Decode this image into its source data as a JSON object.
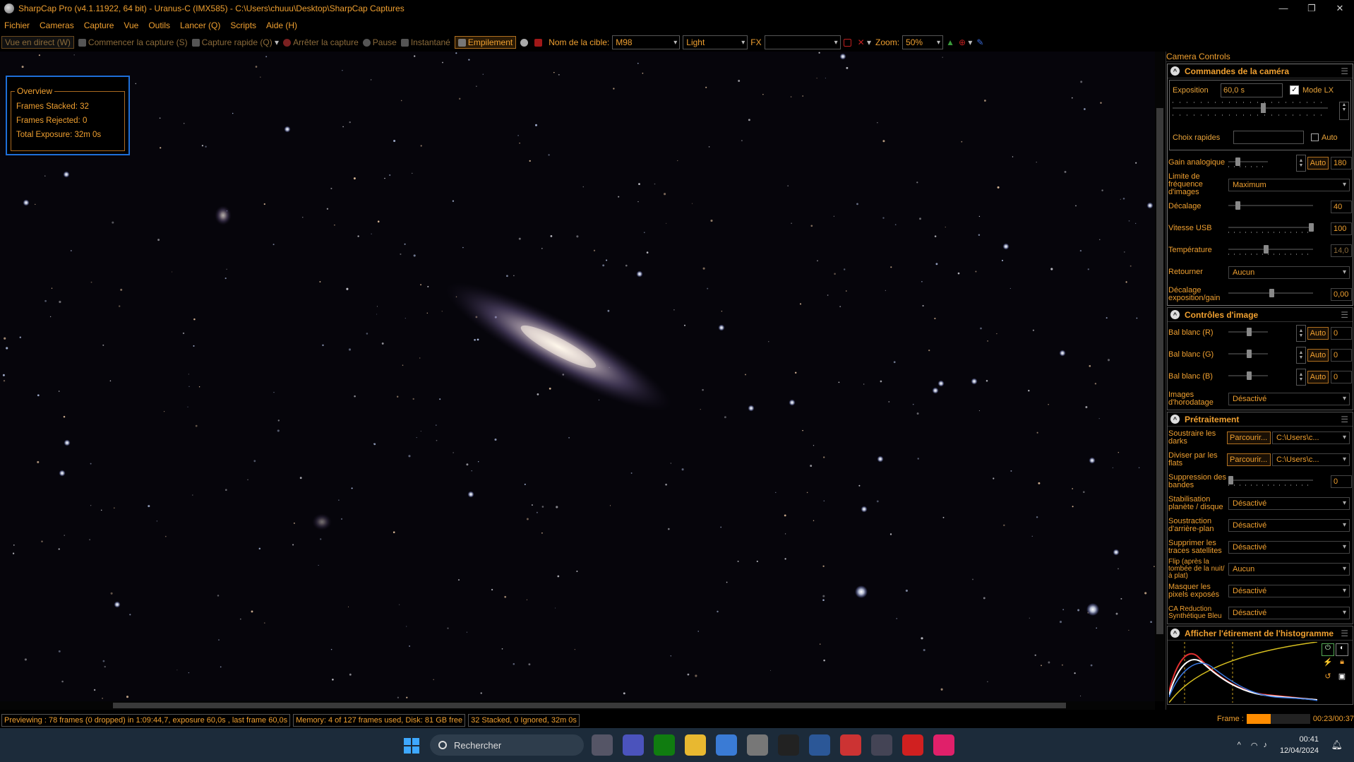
{
  "window": {
    "title": "SharpCap Pro (v4.1.11922, 64 bit) - Uranus-C (IMX585) - C:\\Users\\chuuu\\Desktop\\SharpCap Captures",
    "controls": [
      "—",
      "❐",
      "✕"
    ]
  },
  "menu": [
    "Fichier",
    "Cameras",
    "Capture",
    "Vue",
    "Outils",
    "Lancer (Q)",
    "Scripts",
    "Aide (H)"
  ],
  "toolbar": {
    "live_view": "Vue en direct (W)",
    "start_capture": "Commencer la capture (S)",
    "quick_capture": "Capture rapide (Q)",
    "stop_capture": "Arrêter la capture",
    "pause": "Pause",
    "snapshot": "Instantané",
    "stacking": "Empilement",
    "target_label": "Nom de la cible:",
    "target_value": "M98",
    "frame_type": "Light",
    "fx_label": "FX",
    "fx_value": "",
    "zoom_label": "Zoom:",
    "zoom_value": "50%"
  },
  "overview": {
    "title": "Overview",
    "frames_stacked": "Frames Stacked:   32",
    "frames_rejected": "Frames Rejected: 0",
    "total_exposure": "Total Exposure:    32m 0s"
  },
  "panel": {
    "title": "Camera Controls",
    "camera": {
      "header": "Commandes de la caméra",
      "exposure_label": "Exposition",
      "exposure_value": "60,0 s",
      "lx_mode": "Mode LX",
      "quick_choice": "Choix rapides",
      "auto": "Auto",
      "gain_label": "Gain analogique",
      "gain_value": "180",
      "framerate_label": "Limite de fréquence d'images",
      "framerate_value": "Maximum",
      "offset_label": "Décalage",
      "offset_value": "40",
      "usb_label": "Vitesse USB",
      "usb_value": "100",
      "temp_label": "Température",
      "temp_value": "14,0",
      "flip_label": "Retourner",
      "flip_value": "Aucun",
      "expgain_label": "Décalage exposition/gain",
      "expgain_value": "0,00"
    },
    "image": {
      "header": "Contrôles d'image",
      "wb_r_label": "Bal blanc (R)",
      "wb_r_value": "0",
      "wb_g_label": "Bal blanc (G)",
      "wb_g_value": "0",
      "wb_b_label": "Bal blanc (B)",
      "wb_b_value": "0",
      "timestamp_label": "Images d'horodatage",
      "timestamp_value": "Désactivé",
      "auto": "Auto"
    },
    "preproc": {
      "header": "Prétraitement",
      "darks_label": "Soustraire les darks",
      "flats_label": "Diviser par les flats",
      "browse": "Parcourir...",
      "path": "C:\\Users\\c...",
      "banding_label": "Suppression des bandes",
      "banding_value": "0",
      "stabilize_label": "Stabilisation planète / disque",
      "stabilize_value": "Désactivé",
      "bgsub_label": "Soustraction d'arrière-plan",
      "bgsub_value": "Désactivé",
      "sat_label": "Supprimer les traces satellites",
      "sat_value": "Désactivé",
      "flip_label": "Flip (après la tombée de la nuit/à plat)",
      "flip_value": "Aucun",
      "hotpix_label": "Masquer les pixels exposés",
      "hotpix_value": "Désactivé",
      "ca_label": "CA Reduction Synthétique Bleu",
      "ca_value": "Désactivé"
    },
    "histogram": {
      "header": "Afficher l'étirement de l'histogramme"
    }
  },
  "status": {
    "preview": "Previewing : 78 frames (0 dropped) in 1:09:44,7, exposure 60,0s , last frame 60,0s",
    "memory": "Memory: 4 of 127 frames used, Disk: 81 GB free",
    "stack": "32 Stacked, 0 Ignored, 32m 0s",
    "frame_label": "Frame :",
    "frame_time": "00:23/00:37",
    "frame_progress": 0.38
  },
  "taskbar": {
    "search": "Rechercher",
    "time": "00:41",
    "date": "12/04/2024",
    "app_icons": [
      "task-view-icon",
      "teams-icon",
      "xbox-icon",
      "file-explorer-icon",
      "store-icon",
      "pen-icon",
      "moon-icon",
      "stellarium-icon",
      "multi-icon",
      "sharpcap-icon",
      "asi-icon",
      "other-app-icon"
    ]
  }
}
